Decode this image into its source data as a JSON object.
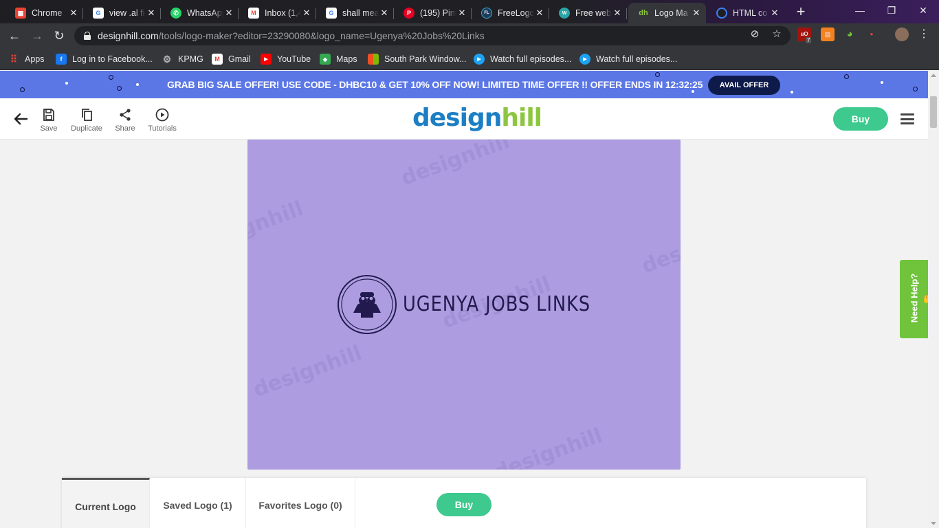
{
  "browser": {
    "tabs": [
      {
        "title": "Chrome",
        "favicon": "chrome-web-store-icon",
        "color": "#e94335"
      },
      {
        "title": "view .al fi",
        "favicon": "google-icon",
        "color": "#4285f4"
      },
      {
        "title": "WhatsApp",
        "favicon": "whatsapp-icon",
        "color": "#25d366"
      },
      {
        "title": "Inbox (1,4",
        "favicon": "gmail-icon",
        "color": "#ea4335"
      },
      {
        "title": "shall mea",
        "favicon": "google-icon",
        "color": "#4285f4"
      },
      {
        "title": "(195) Pint",
        "favicon": "pinterest-icon",
        "color": "#e60023"
      },
      {
        "title": "FreeLogo",
        "favicon": "freelogo-icon",
        "color": "#3fa7c9"
      },
      {
        "title": "Free web",
        "favicon": "web-icon",
        "color": "#2ca5a8"
      },
      {
        "title": "Logo Ma",
        "favicon": "designhill-icon",
        "color": "#8cc63f"
      },
      {
        "title": "HTML co",
        "favicon": "html-icon",
        "color": "#3b82f6"
      }
    ],
    "new_tab": "+",
    "window": {
      "minimize": "—",
      "restore": "❐",
      "close": "✕"
    },
    "url_host": "designhill.com",
    "url_path": "/tools/logo-maker?editor=23290080&logo_name=Ugenya%20Jobs%20Links",
    "ext_badge": "7",
    "bookmarks": [
      {
        "label": "Apps",
        "icon": "apps-grid-icon",
        "color": "#e94335"
      },
      {
        "label": "Log in to Facebook...",
        "icon": "facebook-icon",
        "color": "#1877f2"
      },
      {
        "label": "KPMG",
        "icon": "gear-icon",
        "color": "#9aa0a6"
      },
      {
        "label": "Gmail",
        "icon": "gmail-icon",
        "color": "#ea4335"
      },
      {
        "label": "YouTube",
        "icon": "youtube-icon",
        "color": "#ff0000"
      },
      {
        "label": "Maps",
        "icon": "maps-icon",
        "color": "#34a853"
      },
      {
        "label": "South Park Window...",
        "icon": "windows-icon",
        "color": "#f25022"
      },
      {
        "label": "Watch full episodes...",
        "icon": "play-circle-icon",
        "color": "#1da1f2"
      },
      {
        "label": "Watch full episodes...",
        "icon": "play-circle-icon",
        "color": "#1da1f2"
      }
    ]
  },
  "promo": {
    "text_pre": "GRAB BIG SALE OFFER! USE CODE - ",
    "code": "DHBC10",
    "text_post": " & GET 10% OFF NOW! LIMITED TIME OFFER !! OFFER ENDS IN 12:32:25",
    "button": "AVAIL OFFER",
    "bg_color": "#5b77e6"
  },
  "header": {
    "tools": [
      {
        "label": "Save",
        "icon": "save-icon"
      },
      {
        "label": "Duplicate",
        "icon": "duplicate-icon"
      },
      {
        "label": "Share",
        "icon": "share-icon"
      },
      {
        "label": "Tutorials",
        "icon": "play-circle-icon"
      }
    ],
    "logo_part1": "design",
    "logo_part2": "hill",
    "buy": "Buy"
  },
  "canvas": {
    "bg_color": "#ad9de0",
    "brand_name": "UGENYA  JOBS  LINKS",
    "watermark": "designhill",
    "emblem_icon": "binoculars-person-icon"
  },
  "help": {
    "label": "Need Help?"
  },
  "panel": {
    "tabs": [
      {
        "label": "Current Logo",
        "active": true
      },
      {
        "label": "Saved Logo (1)",
        "active": false
      },
      {
        "label": "Favorites Logo (0)",
        "active": false
      }
    ],
    "buy": "Buy"
  }
}
